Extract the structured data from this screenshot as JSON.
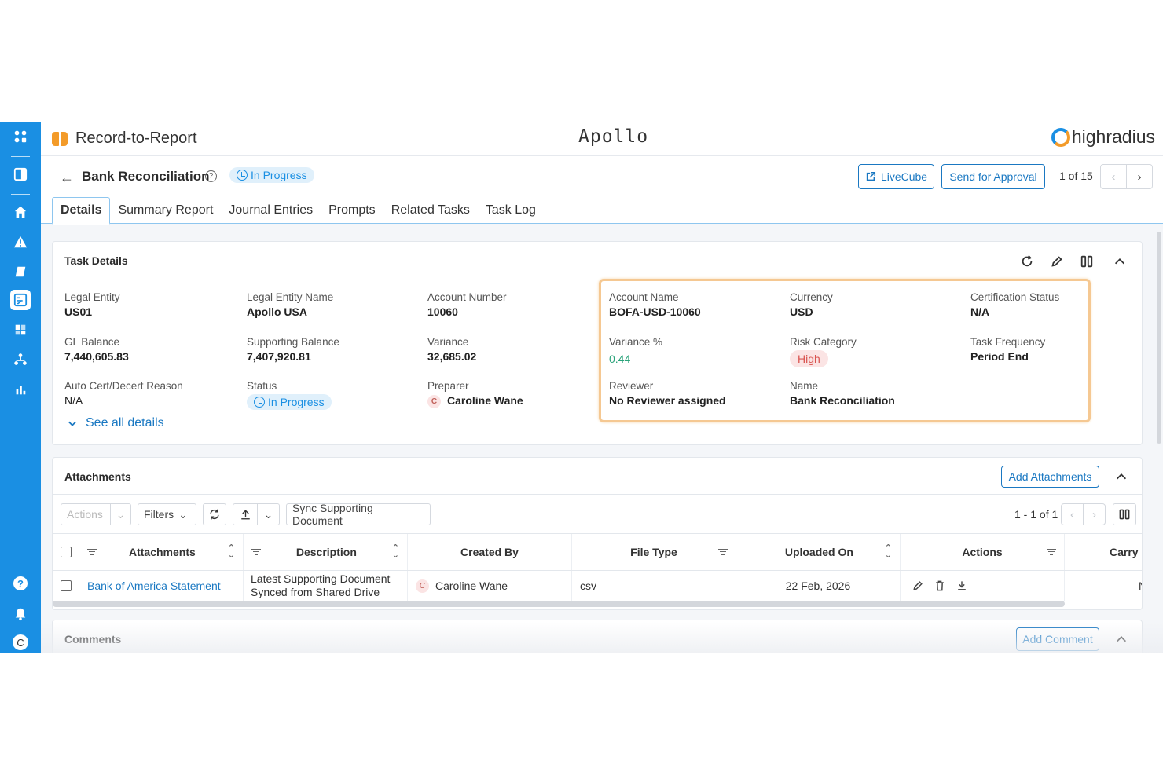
{
  "app": {
    "module_title": "Record-to-Report",
    "brand": "Apollo",
    "company": "highradius"
  },
  "header": {
    "back_label": "←",
    "title": "Bank Reconciliation",
    "help_glyph": "?",
    "status": "In Progress",
    "livecube_label": "LiveCube",
    "send_label": "Send for Approval",
    "pager_text": "1 of 15",
    "prev_glyph": "‹",
    "next_glyph": "›"
  },
  "tabs": [
    {
      "label": "Details",
      "active": true
    },
    {
      "label": "Summary Report"
    },
    {
      "label": "Journal Entries"
    },
    {
      "label": "Prompts"
    },
    {
      "label": "Related Tasks"
    },
    {
      "label": "Task Log"
    }
  ],
  "task_details": {
    "title": "Task Details",
    "fields": {
      "legal_entity": {
        "label": "Legal Entity",
        "value": "US01"
      },
      "legal_entity_name": {
        "label": "Legal Entity Name",
        "value": "Apollo USA"
      },
      "account_number": {
        "label": "Account Number",
        "value": "10060"
      },
      "account_name": {
        "label": "Account Name",
        "value": "BOFA-USD-10060"
      },
      "currency": {
        "label": "Currency",
        "value": "USD"
      },
      "certification_status": {
        "label": "Certification Status",
        "value": "N/A"
      },
      "gl_balance": {
        "label": "GL Balance",
        "value": "7,440,605.83"
      },
      "supporting_balance": {
        "label": "Supporting Balance",
        "value": "7,407,920.81"
      },
      "variance": {
        "label": "Variance",
        "value": "32,685.02"
      },
      "variance_pct": {
        "label": "Variance %",
        "value": "0.44"
      },
      "risk_category": {
        "label": "Risk Category",
        "value": "High"
      },
      "task_frequency": {
        "label": "Task Frequency",
        "value": "Period End"
      },
      "auto_cert": {
        "label": "Auto Cert/Decert Reason",
        "value": "N/A"
      },
      "status": {
        "label": "Status",
        "value": "In Progress"
      },
      "preparer": {
        "label": "Preparer",
        "value": "Caroline Wane",
        "initial": "C"
      },
      "reviewer": {
        "label": "Reviewer",
        "value": "No Reviewer assigned"
      },
      "name": {
        "label": "Name",
        "value": "Bank Reconciliation"
      }
    },
    "see_all": "See all details"
  },
  "attachments": {
    "title": "Attachments",
    "add_label": "Add Attachments",
    "toolbar": {
      "actions": "Actions",
      "filters": "Filters",
      "sync": "Sync Supporting Document",
      "range": "1 - 1 of 1"
    },
    "columns": [
      "Attachments",
      "Description",
      "Created By",
      "File Type",
      "Uploaded On",
      "Actions",
      "Carry I"
    ],
    "rows": [
      {
        "attachment": "Bank of America Statement",
        "description_line1": "Latest Supporting Document",
        "description_line2": "Synced from Shared Drive",
        "created_by": "Caroline Wane",
        "created_initial": "C",
        "file_type": "csv",
        "uploaded_on": "22 Feb, 2026",
        "carry": "N"
      }
    ]
  },
  "comments": {
    "title": "Comments",
    "add_label": "Add Comment"
  },
  "rail": {
    "help_glyph": "?",
    "user_initial": "C"
  },
  "colors": {
    "rail": "#1a8fe3",
    "accent": "#1a78c2",
    "highlight_border": "#f5c892",
    "risk_high": "#d9534f",
    "variance_positive": "#2aa37a"
  }
}
